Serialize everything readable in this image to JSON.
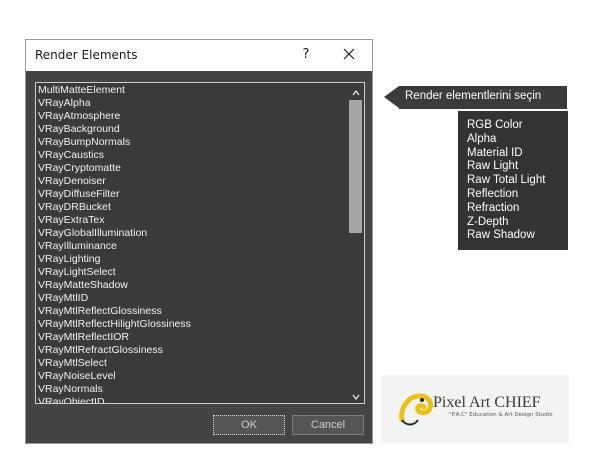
{
  "dialog": {
    "title": "Render Elements",
    "help_label": "?",
    "items": [
      "MultiMatteElement",
      "VRayAlpha",
      "VRayAtmosphere",
      "VRayBackground",
      "VRayBumpNormals",
      "VRayCaustics",
      "VRayCryptomatte",
      "VRayDenoiser",
      "VRayDiffuseFilter",
      "VRayDRBucket",
      "VRayExtraTex",
      "VRayGlobalIllumination",
      "VRayIlluminance",
      "VRayLighting",
      "VRayLightSelect",
      "VRayMatteShadow",
      "VRayMtlID",
      "VRayMtlReflectGlossiness",
      "VRayMtlReflectHilightGlossiness",
      "VRayMtlReflectIOR",
      "VRayMtlRefractGlossiness",
      "VRayMtlSelect",
      "VRayNoiseLevel",
      "VRayNormals",
      "VRayObjectID"
    ],
    "ok_label": "OK",
    "cancel_label": "Cancel"
  },
  "callout": {
    "text": "Render elementlerini seçin",
    "list": [
      "RGB Color",
      "Alpha",
      "Material ID",
      "Raw Light",
      "Raw Total Light",
      "Reflection",
      "Refraction",
      "Z-Depth",
      "Raw Shadow"
    ]
  },
  "logo": {
    "name": "Pixel Art CHIEF",
    "tagline": "\"P.A.C\" Education & Art Design Studio"
  },
  "colors": {
    "dialog_bg": "#444444",
    "list_bg": "#3a3a3a",
    "callout_bg": "#3b3b3b",
    "logo_accent": "#e8c21a"
  }
}
